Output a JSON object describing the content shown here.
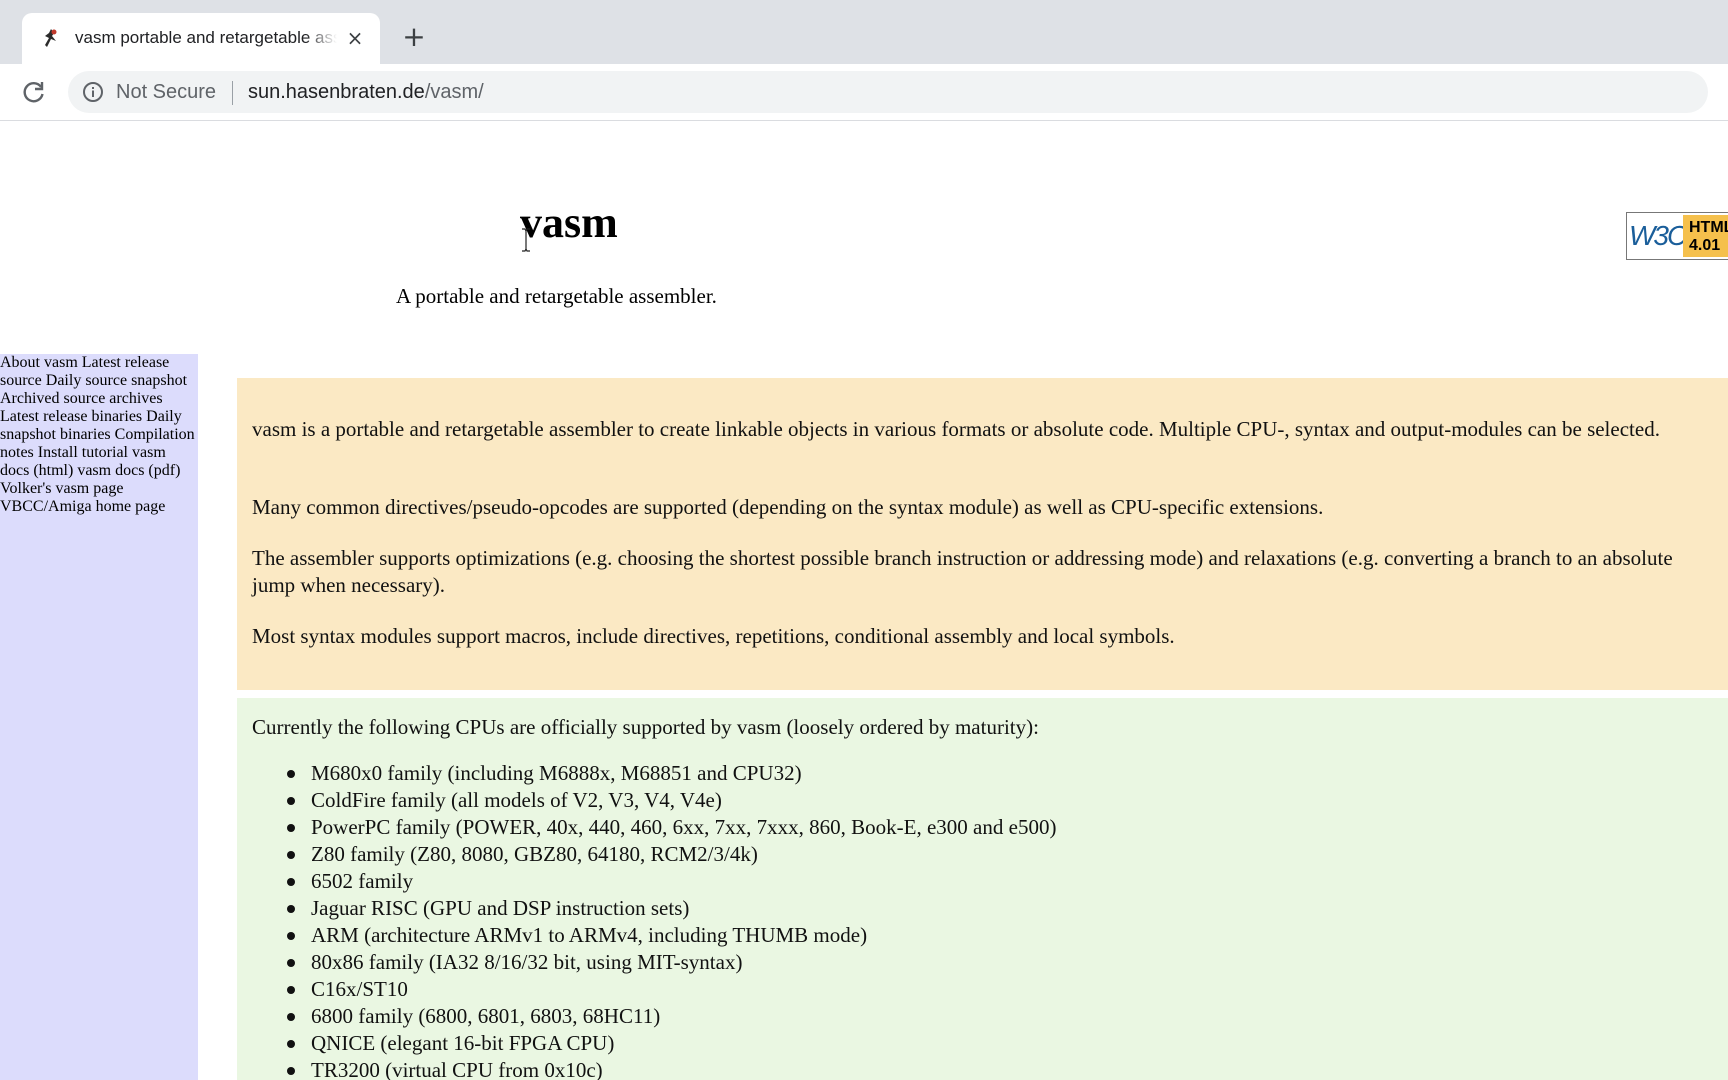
{
  "browser": {
    "tab": {
      "title": "vasm portable and retargetable assembler",
      "close": "×"
    },
    "new_tab": "+",
    "security_label": "Not Secure",
    "url_host": "sun.hasenbraten.de",
    "url_path": "/vasm/"
  },
  "page": {
    "title": "vasm",
    "subtitle": "A portable and retargetable assembler.",
    "w3c_badge": {
      "logo": "W3C",
      "line1": "HTML",
      "line2": "4.01"
    },
    "sidebar_links": [
      "About vasm",
      "Latest release source",
      "Daily source snapshot",
      "Archived source archives",
      "Latest release binaries",
      "Daily snapshot binaries",
      "Compilation notes",
      "Install tutorial",
      "vasm docs (html)",
      "vasm docs (pdf)",
      "Volker's vasm page",
      "VBCC/Amiga home page"
    ],
    "intro_paragraphs": [
      "vasm is a portable and retargetable assembler to create linkable objects in various formats or absolute code. Multiple CPU-, syntax and output-modules can be selected.",
      "Many common directives/pseudo-opcodes are supported (depending on the syntax module) as well as CPU-specific extensions.",
      "The assembler supports optimizations (e.g. choosing the shortest possible branch instruction or addressing mode) and relaxations (e.g. converting a branch to an absolute jump when necessary).",
      "Most syntax modules support macros, include directives, repetitions, conditional assembly and local symbols."
    ],
    "cpu_intro": "Currently the following CPUs are officially supported by vasm (loosely ordered by maturity):",
    "cpus": [
      "M680x0 family (including M6888x, M68851 and CPU32)",
      "ColdFire family (all models of V2, V3, V4, V4e)",
      "PowerPC family (POWER, 40x, 440, 460, 6xx, 7xx, 7xxx, 860, Book-E, e300 and e500)",
      "Z80 family (Z80, 8080, GBZ80, 64180, RCM2/3/4k)",
      "6502 family",
      "Jaguar RISC (GPU and DSP instruction sets)",
      "ARM (architecture ARMv1 to ARMv4, including THUMB mode)",
      "80x86 family (IA32 8/16/32 bit, using MIT-syntax)",
      "C16x/ST10",
      "6800 family (6800, 6801, 6803, 68HC11)",
      "QNICE (elegant 16-bit FPGA CPU)",
      "TR3200 (virtual CPU from 0x10c)"
    ]
  }
}
